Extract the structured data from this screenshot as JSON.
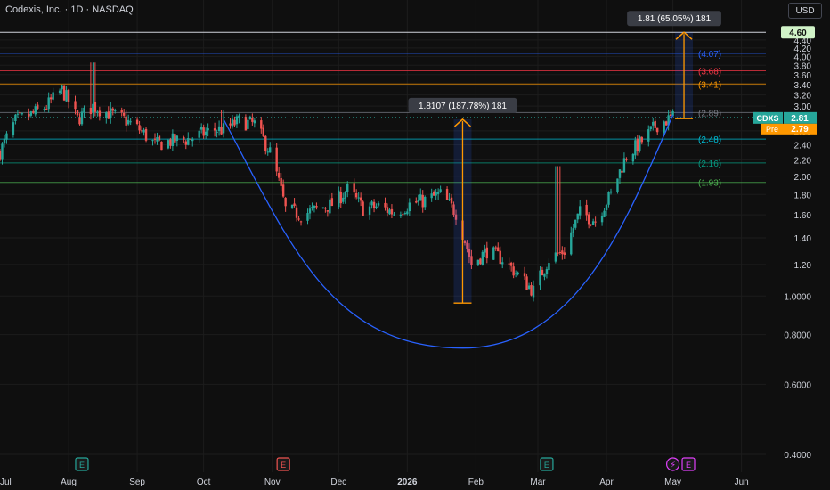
{
  "header": {
    "title": "Codexis, Inc. · 1D · NASDAQ",
    "currency_label": "USD"
  },
  "colors": {
    "bull": "#26a69a",
    "bear": "#ef5350",
    "grid": "#1c1c1c",
    "arc": "#2962ff",
    "measure": "#ff9800"
  },
  "chart_data": {
    "type": "candlestick",
    "x_axis": {
      "type": "date",
      "range": [
        "2025-07-01",
        "2026-06-12"
      ],
      "ticks": [
        {
          "date": "2025-07-01",
          "label": "Jul"
        },
        {
          "date": "2025-08-01",
          "label": "Aug"
        },
        {
          "date": "2025-09-01",
          "label": "Sep"
        },
        {
          "date": "2025-10-01",
          "label": "Oct"
        },
        {
          "date": "2025-11-01",
          "label": "Nov"
        },
        {
          "date": "2025-12-01",
          "label": "Dec"
        },
        {
          "date": "2026-01-01",
          "label": "2026"
        },
        {
          "date": "2026-02-01",
          "label": "Feb"
        },
        {
          "date": "2026-03-01",
          "label": "Mar"
        },
        {
          "date": "2026-04-01",
          "label": "Apr"
        },
        {
          "date": "2026-05-01",
          "label": "May"
        },
        {
          "date": "2026-06-01",
          "label": "Jun"
        }
      ]
    },
    "y_axis": {
      "scale": "log",
      "range": [
        0.38,
        4.75
      ],
      "ticks": [
        "0.4000",
        "0.6000",
        "0.8000",
        "1.0000",
        "1.20",
        "1.40",
        "1.60",
        "1.80",
        "2.00",
        "2.20",
        "2.40",
        "2.60",
        "2.80",
        "3.00",
        "3.20",
        "3.40",
        "3.60",
        "3.80",
        "4.00",
        "4.20",
        "4.40"
      ]
    },
    "price_path": [
      [
        "2025-07-01",
        2.3
      ],
      [
        "2025-07-08",
        2.75
      ],
      [
        "2025-07-15",
        2.85
      ],
      [
        "2025-07-22",
        3.0
      ],
      [
        "2025-07-29",
        3.3
      ],
      [
        "2025-08-05",
        2.78
      ],
      [
        "2025-08-12",
        3.0
      ],
      [
        "2025-08-19",
        2.88
      ],
      [
        "2025-08-26",
        2.78
      ],
      [
        "2025-09-02",
        2.62
      ],
      [
        "2025-09-09",
        2.4
      ],
      [
        "2025-09-16",
        2.45
      ],
      [
        "2025-09-23",
        2.47
      ],
      [
        "2025-09-30",
        2.55
      ],
      [
        "2025-10-06",
        2.62
      ],
      [
        "2025-10-10",
        2.62
      ],
      [
        "2025-10-17",
        2.75
      ],
      [
        "2025-10-24",
        2.7
      ],
      [
        "2025-10-31",
        2.3
      ],
      [
        "2025-11-07",
        1.65
      ],
      [
        "2025-11-14",
        1.6
      ],
      [
        "2025-11-21",
        1.65
      ],
      [
        "2025-11-28",
        1.7
      ],
      [
        "2025-12-05",
        1.85
      ],
      [
        "2025-12-12",
        1.66
      ],
      [
        "2025-12-19",
        1.68
      ],
      [
        "2025-12-26",
        1.62
      ],
      [
        "2026-01-02",
        1.7
      ],
      [
        "2026-01-09",
        1.74
      ],
      [
        "2026-01-16",
        1.8
      ],
      [
        "2026-01-23",
        1.62
      ],
      [
        "2026-01-30",
        1.2
      ],
      [
        "2026-02-06",
        1.3
      ],
      [
        "2026-02-13",
        1.24
      ],
      [
        "2026-02-20",
        1.13
      ],
      [
        "2026-02-27",
        1.03
      ],
      [
        "2026-03-06",
        1.24
      ],
      [
        "2026-03-13",
        1.3
      ],
      [
        "2026-03-20",
        1.62
      ],
      [
        "2026-03-27",
        1.55
      ],
      [
        "2026-04-03",
        1.8
      ],
      [
        "2026-04-10",
        2.25
      ],
      [
        "2026-04-17",
        2.45
      ],
      [
        "2026-04-24",
        2.7
      ],
      [
        "2026-05-01",
        2.81
      ]
    ],
    "notable_candles": [
      {
        "date": "2025-08-12",
        "high": 3.86,
        "note": "spike high"
      },
      {
        "date": "2025-10-10",
        "high": 2.93
      },
      {
        "date": "2026-03-10",
        "high": 2.12
      }
    ],
    "cup_arc": {
      "start": [
        "2025-10-10",
        2.78
      ],
      "bottom": [
        "2026-01-26",
        0.74
      ],
      "end": [
        "2026-05-01",
        2.85
      ]
    },
    "fib_levels": [
      {
        "label": "(4.07)",
        "value": 4.07,
        "color": "#2962ff"
      },
      {
        "label": "(3.68)",
        "value": 3.68,
        "color": "#f23645"
      },
      {
        "label": "(3.41)",
        "value": 3.41,
        "color": "#ff9800"
      },
      {
        "label": "(2.89)",
        "value": 2.89,
        "color": "#787b86"
      },
      {
        "label": "(2.48)",
        "value": 2.48,
        "color": "#00bcd4"
      },
      {
        "label": "(2.16)",
        "value": 2.16,
        "color": "#089981"
      },
      {
        "label": "(1.93)",
        "value": 1.93,
        "color": "#4caf50"
      }
    ],
    "top_line": {
      "value": 4.6,
      "label": "4.60"
    },
    "measures": [
      {
        "date": "2026-01-26",
        "from": 0.96,
        "to": 2.78,
        "label": "1.8107 (187.78%) 181"
      },
      {
        "date": "2026-05-06",
        "from": 2.79,
        "to": 4.6,
        "label": "1.81 (65.05%) 181"
      }
    ],
    "last_price": {
      "symbol": "CDXS",
      "value": "2.81",
      "pre_label": "Pre",
      "pre_value": "2.79"
    },
    "events": [
      {
        "date": "2025-08-07",
        "label": "E",
        "color": "#26a69a"
      },
      {
        "date": "2025-11-06",
        "label": "E",
        "color": "#ef5350"
      },
      {
        "date": "2026-03-05",
        "label": "E",
        "color": "#26a69a"
      },
      {
        "date": "2026-05-01",
        "label": "⚡",
        "color": "#e040fb"
      },
      {
        "date": "2026-05-08",
        "label": "E",
        "color": "#e040fb"
      }
    ]
  }
}
